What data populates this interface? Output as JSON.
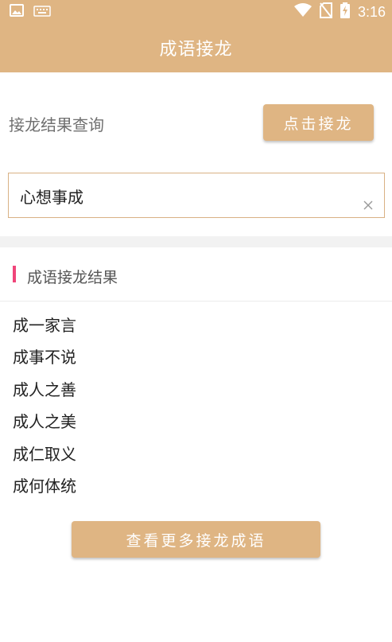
{
  "status_bar": {
    "time": "3:16",
    "icons": [
      "image-icon",
      "keyboard-icon",
      "wifi-icon",
      "no-sim-icon",
      "battery-charging-icon"
    ]
  },
  "header": {
    "title": "成语接龙"
  },
  "query": {
    "label": "接龙结果查询",
    "button_label": "点击接龙",
    "input_value": "心想事成"
  },
  "results": {
    "title": "成语接龙结果",
    "items": [
      "成一家言",
      "成事不说",
      "成人之善",
      "成人之美",
      "成仁取义",
      "成何体统"
    ]
  },
  "more_button_label": "查看更多接龙成语",
  "colors": {
    "brand": "#dfb583",
    "accent": "#f0457a"
  }
}
